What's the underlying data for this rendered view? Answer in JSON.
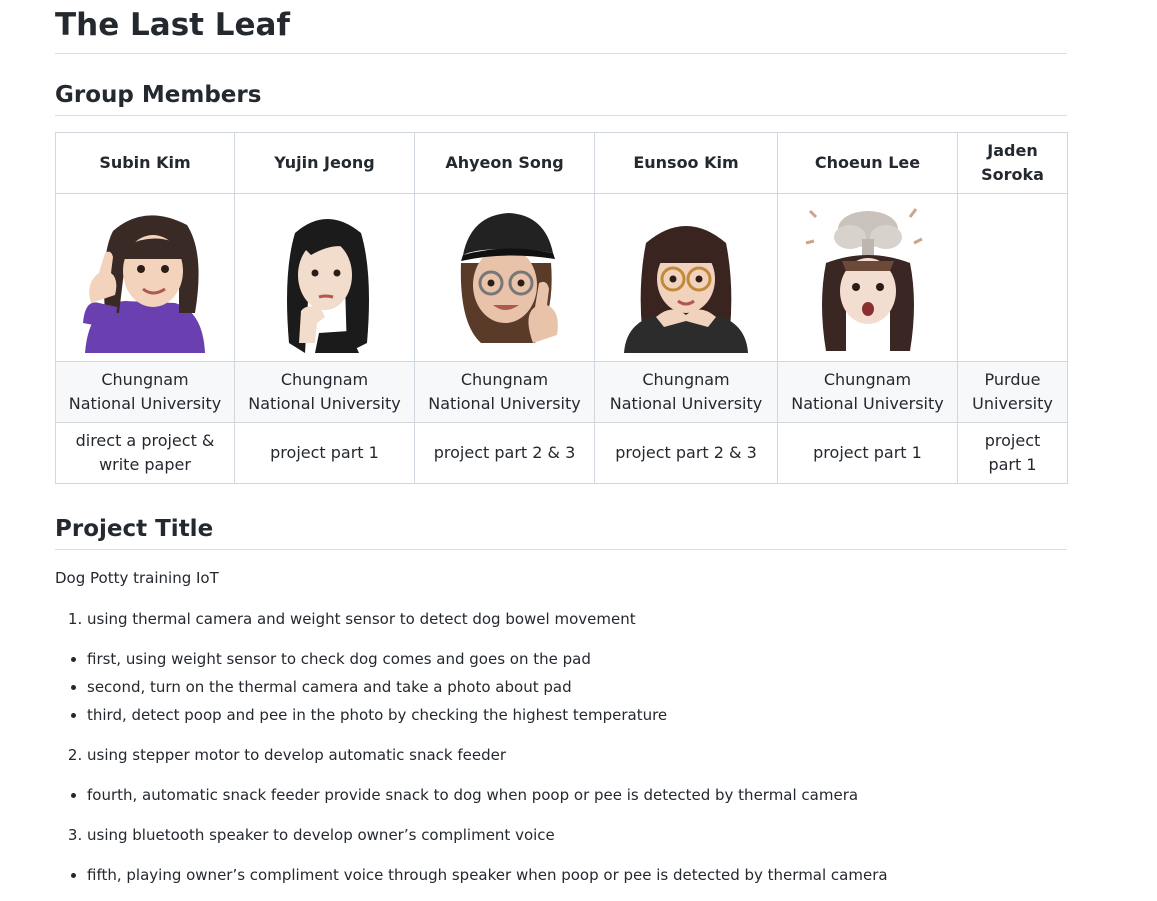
{
  "page": {
    "title": "The Last Leaf",
    "members_heading": "Group Members",
    "project_heading": "Project Title",
    "project_description": "Dog Potty training IoT"
  },
  "members": [
    {
      "name": "Subin Kim",
      "school": "Chungnam National University",
      "role": "direct a project & write paper",
      "avatar": "memoji-thumbs-up-purple-sweater"
    },
    {
      "name": "Yujin Jeong",
      "school": "Chungnam National University",
      "role": "project part 1",
      "avatar": "memoji-thinking"
    },
    {
      "name": "Ahyeon Song",
      "school": "Chungnam National University",
      "role": "project part 2 & 3",
      "avatar": "memoji-cap-glasses-thumbs-up"
    },
    {
      "name": "Eunsoo Kim",
      "school": "Chungnam National University",
      "role": "project part 2 & 3",
      "avatar": "memoji-glasses-hands-chin"
    },
    {
      "name": "Choeun Lee",
      "school": "Chungnam National University",
      "role": "project part 1",
      "avatar": "memoji-mind-blown"
    },
    {
      "name": "Jaden Soroka",
      "school": "Purdue University",
      "role": "project part 1",
      "avatar": ""
    }
  ],
  "project": {
    "steps": [
      {
        "number": "1.",
        "text": "using thermal camera and weight sensor to detect dog bowel movement",
        "bullets": [
          "first, using weight sensor to check dog comes and goes on the pad",
          "second, turn on the thermal camera and take a photo about pad",
          "third, detect poop and pee in the photo by checking the highest temperature"
        ]
      },
      {
        "number": "2.",
        "text": "using stepper motor to develop automatic snack feeder",
        "bullets": [
          "fourth, automatic snack feeder provide snack to dog when poop or pee is detected by thermal camera"
        ]
      },
      {
        "number": "3.",
        "text": "using bluetooth speaker to develop owner’s compliment voice",
        "bullets": [
          "fifth, playing owner’s compliment voice through speaker when poop or pee is detected by thermal camera"
        ]
      }
    ]
  }
}
